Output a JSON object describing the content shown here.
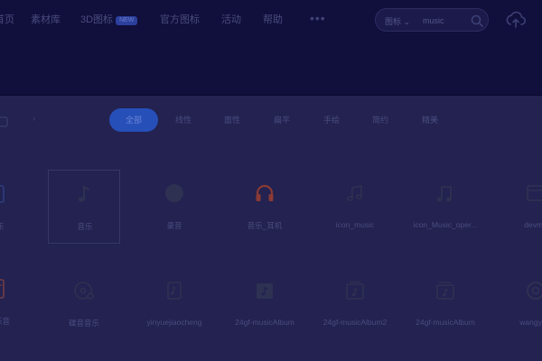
{
  "colors": {
    "background": "#232250",
    "topbar": "#110f3b",
    "accent": "#264fb8",
    "icon": "#2f3152",
    "icon_red": "#8a3a35"
  },
  "nav": {
    "items": [
      {
        "label": "素材库"
      },
      {
        "label": "3D图标",
        "badge": "NEW"
      },
      {
        "label": "官方图标"
      },
      {
        "label": "活动"
      },
      {
        "label": "帮助"
      }
    ],
    "partial_first": "首页",
    "more": "•••"
  },
  "search": {
    "type_label": "图标",
    "type_caret": "⌄",
    "placeholder": "music",
    "value": "music"
  },
  "filters": {
    "items": [
      "全部",
      "线性",
      "面性",
      "扁平",
      "手绘",
      "简约",
      "精美"
    ],
    "active_index": 0
  },
  "grid": {
    "row1_partial_label": "乐",
    "row1": [
      {
        "label": "音乐",
        "icon": "music-note-icon"
      },
      {
        "label": "录音",
        "icon": "record-dot-icon"
      },
      {
        "label": "音乐_耳机",
        "icon": "headphones-icon"
      },
      {
        "label": "icon_music",
        "icon": "music-notes-icon"
      },
      {
        "label": "icon_Music_oper...",
        "icon": "double-note-icon"
      },
      {
        "label": "devmo",
        "icon": "album-icon"
      }
    ],
    "row2_partial_label": "乐音",
    "row2": [
      {
        "label": "碟音音乐",
        "icon": "disc-music-icon"
      },
      {
        "label": "yinyuejiaocheng",
        "icon": "music-book-icon"
      },
      {
        "label": "24gf-musicAlbum",
        "icon": "music-album-icon"
      },
      {
        "label": "24gf-musicAlbum2",
        "icon": "music-album-outline-icon"
      },
      {
        "label": "24gf-musicAlbum",
        "icon": "music-album-stack-icon"
      },
      {
        "label": "wangyiyu",
        "icon": "netease-music-icon"
      }
    ]
  }
}
